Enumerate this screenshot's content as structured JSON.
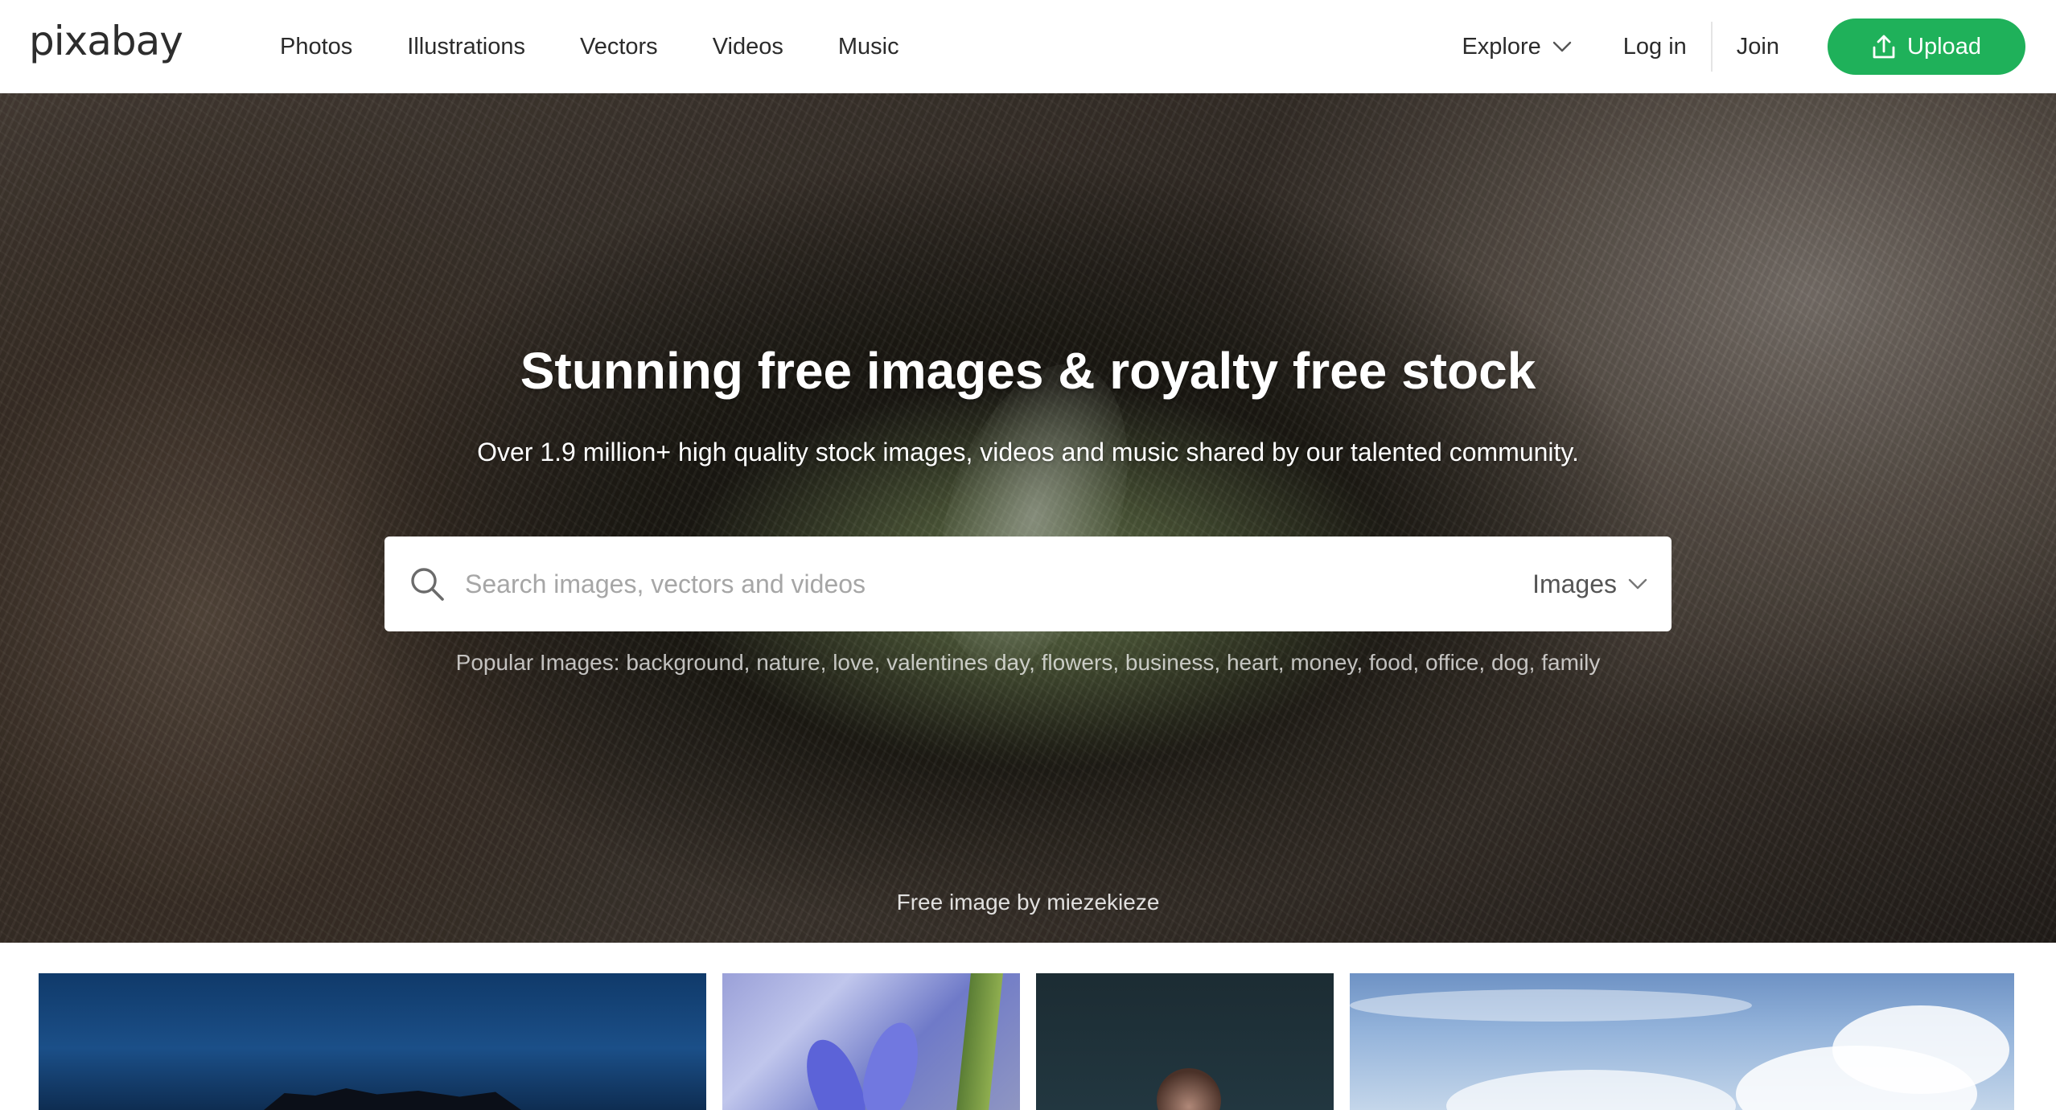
{
  "header": {
    "logo": "pixabay",
    "nav": [
      "Photos",
      "Illustrations",
      "Vectors",
      "Videos",
      "Music"
    ],
    "explore_label": "Explore",
    "login_label": "Log in",
    "join_label": "Join",
    "upload_label": "Upload"
  },
  "hero": {
    "title": "Stunning free images & royalty free stock",
    "subtitle": "Over 1.9 million+ high quality stock images, videos and music shared by our talented community.",
    "search": {
      "placeholder": "Search images, vectors and videos",
      "value": "",
      "type_selected": "Images"
    },
    "popular_label": "Popular Images:",
    "popular_tags": [
      "background",
      "nature",
      "love",
      "valentines day",
      "flowers",
      "business",
      "heart",
      "money",
      "food",
      "office",
      "dog",
      "family"
    ],
    "credit": "Free image by miezekieze"
  },
  "icons": {
    "explore": "chevron-down-icon",
    "upload": "upload-icon",
    "search": "search-icon",
    "search_type": "chevron-down-icon"
  },
  "colors": {
    "brand_green": "#1fb15a",
    "text_dark": "#2b2b2b",
    "placeholder": "#a6a6a6"
  }
}
